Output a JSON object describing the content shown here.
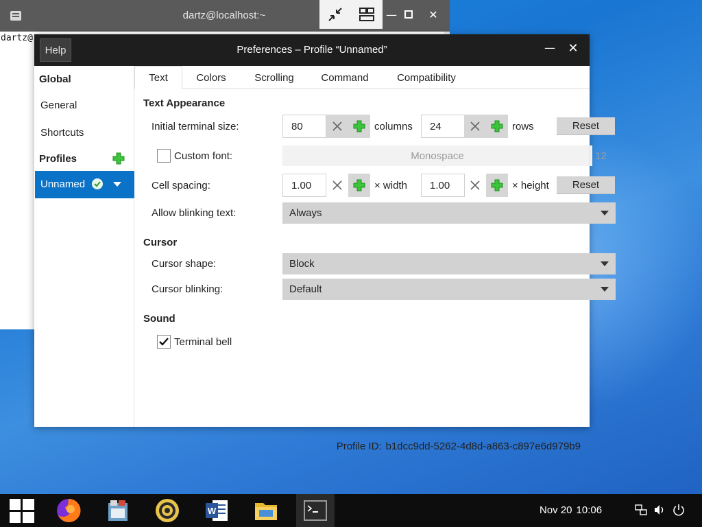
{
  "terminal": {
    "title": "dartz@localhost:~",
    "prompt_text": "dartz@"
  },
  "dialog": {
    "help_label": "Help",
    "title": "Preferences – Profile “Unnamed”",
    "minimize_glyph": "—",
    "close_glyph": "✕"
  },
  "sidebar": {
    "global_heading": "Global",
    "items": [
      {
        "label": "General"
      },
      {
        "label": "Shortcuts"
      }
    ],
    "profiles_heading": "Profiles",
    "selected_profile": "Unnamed"
  },
  "tabs": [
    {
      "label": "Text",
      "active": true
    },
    {
      "label": "Colors"
    },
    {
      "label": "Scrolling"
    },
    {
      "label": "Command"
    },
    {
      "label": "Compatibility"
    }
  ],
  "text_appearance": {
    "heading": "Text Appearance",
    "initial_size_label": "Initial terminal size:",
    "columns_value": "80",
    "columns_unit": "columns",
    "rows_value": "24",
    "rows_unit": "rows",
    "reset_label": "Reset",
    "custom_font_label": "Custom font:",
    "custom_font_checked": false,
    "font_name": "Monospace",
    "font_size": "12",
    "cell_spacing_label": "Cell spacing:",
    "width_value": "1.00",
    "width_unit": "× width",
    "height_value": "1.00",
    "height_unit": "× height",
    "reset2_label": "Reset",
    "blink_label": "Allow blinking text:",
    "blink_value": "Always"
  },
  "cursor": {
    "heading": "Cursor",
    "shape_label": "Cursor shape:",
    "shape_value": "Block",
    "blinking_label": "Cursor blinking:",
    "blinking_value": "Default"
  },
  "sound": {
    "heading": "Sound",
    "bell_label": "Terminal bell",
    "bell_checked": true
  },
  "profile_id": {
    "label": "Profile ID:",
    "value": "b1dcc9dd-5262-4d8d-a863-c897e6d979b9"
  },
  "taskbar": {
    "apps": [
      "start-icon",
      "firefox-icon",
      "file-manager-icon",
      "music-player-icon",
      "word-icon",
      "files-folder-icon",
      "terminal-icon"
    ],
    "date": "Nov 20",
    "time": "10:06"
  },
  "colors": {
    "accent": "#0a73c8",
    "titlebar": "#1e1e1e",
    "plus_green": "#2fb52f"
  }
}
